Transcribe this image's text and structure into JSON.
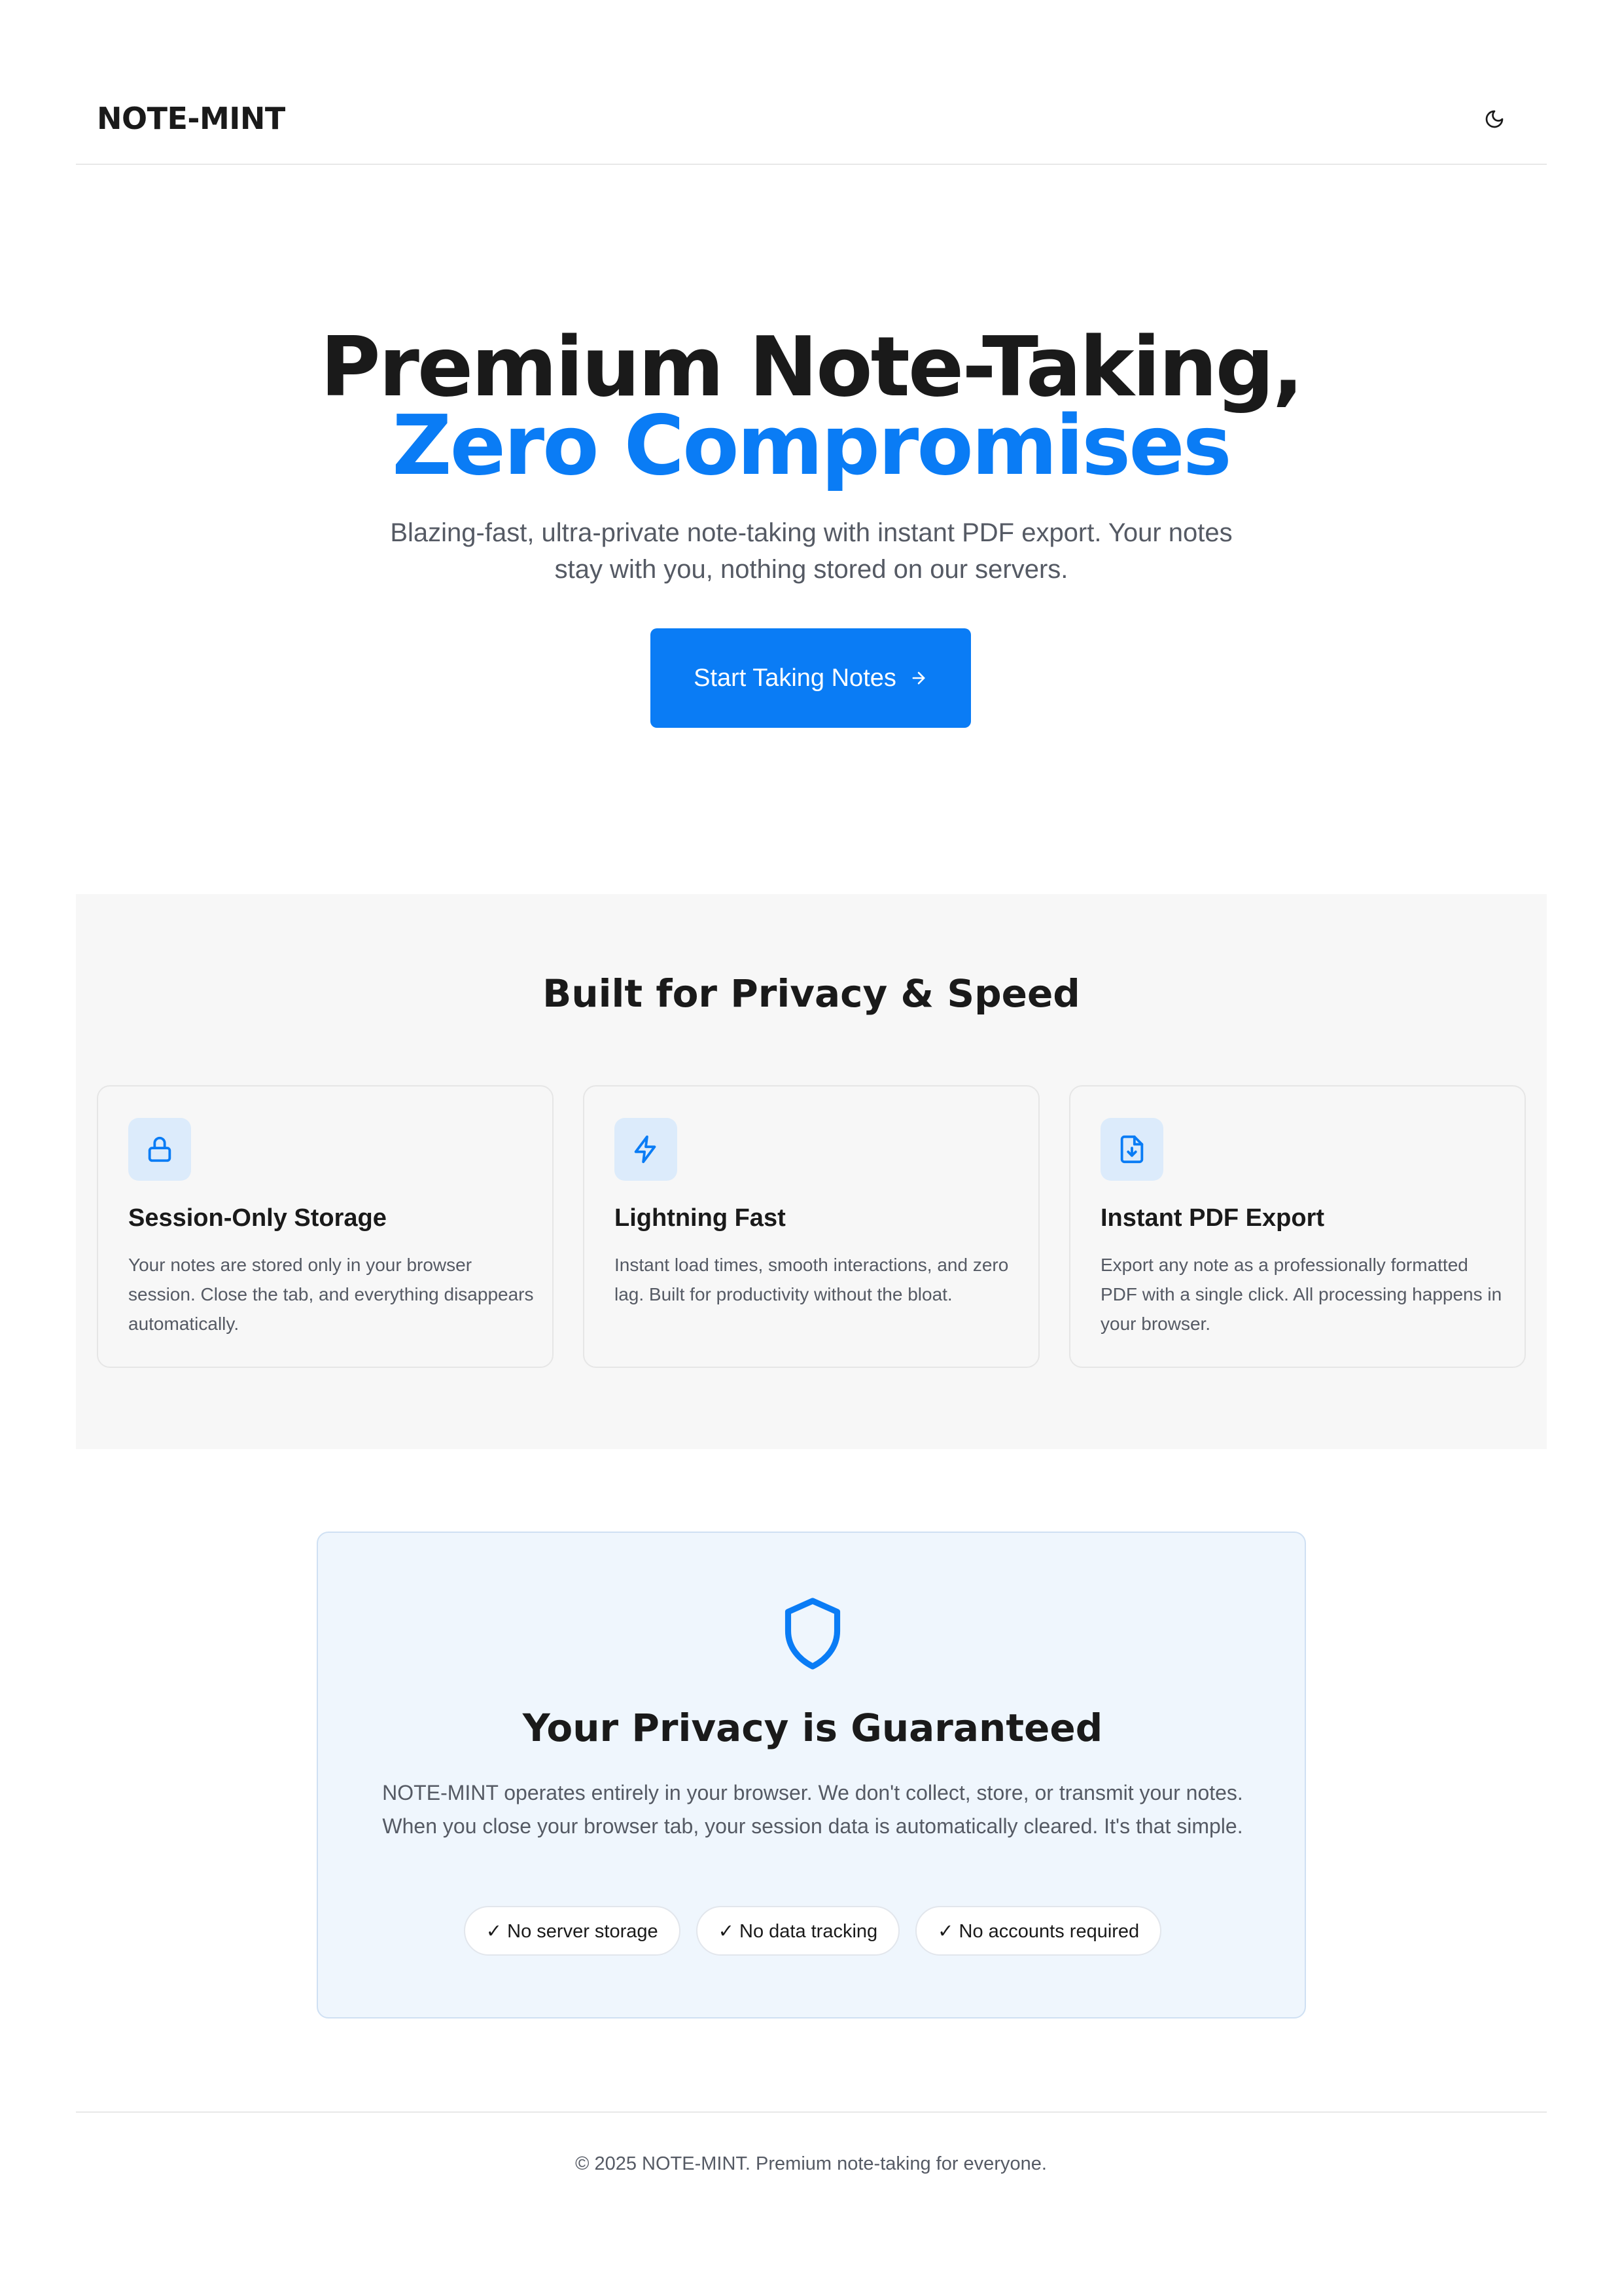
{
  "header": {
    "logo": "NOTE-MINT",
    "theme_toggle_icon": "moon-icon"
  },
  "hero": {
    "title_line1": "Premium Note-Taking,",
    "title_line2": "Zero Compromises",
    "subtitle": "Blazing-fast, ultra-private note-taking with instant PDF export. Your notes stay with you, nothing stored on our servers.",
    "cta_label": "Start Taking Notes",
    "cta_icon": "arrow-right-icon"
  },
  "features": {
    "title": "Built for Privacy & Speed",
    "cards": [
      {
        "icon": "lock-icon",
        "title": "Session-Only Storage",
        "description": "Your notes are stored only in your browser session. Close the tab, and everything disappears automatically."
      },
      {
        "icon": "lightning-icon",
        "title": "Lightning Fast",
        "description": "Instant load times, smooth interactions, and zero lag. Built for productivity without the bloat."
      },
      {
        "icon": "file-download-icon",
        "title": "Instant PDF Export",
        "description": "Export any note as a professionally formatted PDF with a single click. All processing happens in your browser."
      }
    ]
  },
  "privacy": {
    "icon": "shield-icon",
    "title": "Your Privacy is Guaranteed",
    "text": "NOTE-MINT operates entirely in your browser. We don't collect, store, or transmit your notes. When you close your browser tab, your session data is automatically cleared. It's that simple.",
    "pills": [
      "✓ No server storage",
      "✓ No data tracking",
      "✓ No accounts required"
    ]
  },
  "footer": {
    "text": "© 2025 NOTE-MINT. Premium note-taking for everyone."
  },
  "colors": {
    "accent": "#0a7cf5",
    "text": "#1a1a1a",
    "muted": "#555a64",
    "section_bg": "#f7f7f7",
    "privacy_bg": "#eff6fd"
  }
}
